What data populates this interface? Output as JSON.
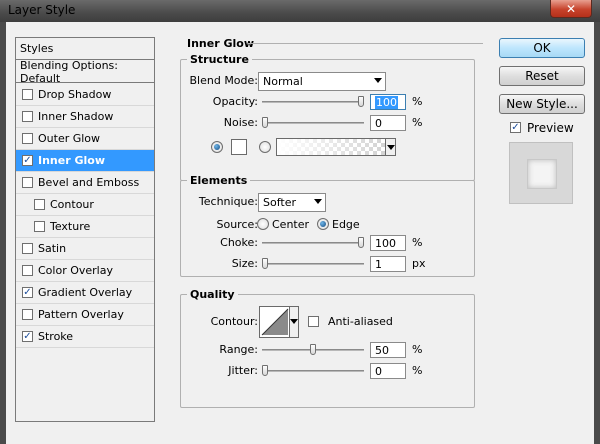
{
  "window": {
    "title": "Layer Style",
    "close_glyph": "✕"
  },
  "styles_panel": {
    "header": "Styles",
    "blending": "Blending Options: Default",
    "items": [
      {
        "label": "Drop Shadow",
        "checked": false,
        "selected": false,
        "indent": false
      },
      {
        "label": "Inner Shadow",
        "checked": false,
        "selected": false,
        "indent": false
      },
      {
        "label": "Outer Glow",
        "checked": false,
        "selected": false,
        "indent": false
      },
      {
        "label": "Inner Glow",
        "checked": true,
        "selected": true,
        "indent": false
      },
      {
        "label": "Bevel and Emboss",
        "checked": false,
        "selected": false,
        "indent": false
      },
      {
        "label": "Contour",
        "checked": false,
        "selected": false,
        "indent": true
      },
      {
        "label": "Texture",
        "checked": false,
        "selected": false,
        "indent": true
      },
      {
        "label": "Satin",
        "checked": false,
        "selected": false,
        "indent": false
      },
      {
        "label": "Color Overlay",
        "checked": false,
        "selected": false,
        "indent": false
      },
      {
        "label": "Gradient Overlay",
        "checked": true,
        "selected": false,
        "indent": false
      },
      {
        "label": "Pattern Overlay",
        "checked": false,
        "selected": false,
        "indent": false
      },
      {
        "label": "Stroke",
        "checked": true,
        "selected": false,
        "indent": false
      }
    ]
  },
  "inner_glow": {
    "title": "Inner Glow",
    "structure": {
      "title": "Structure",
      "blend_mode_label": "Blend Mode:",
      "blend_mode_value": "Normal",
      "opacity_label": "Opacity:",
      "opacity_value": "100",
      "opacity_unit": "%",
      "opacity_level": 1.0,
      "noise_label": "Noise:",
      "noise_value": "0",
      "noise_unit": "%",
      "noise_level": 0.0,
      "color_mode": "solid",
      "glow_color": "#ffffff"
    },
    "elements": {
      "title": "Elements",
      "technique_label": "Technique:",
      "technique_value": "Softer",
      "source_label": "Source:",
      "source_center": "Center",
      "source_edge": "Edge",
      "source_selected": "Edge",
      "choke_label": "Choke:",
      "choke_value": "100",
      "choke_unit": "%",
      "choke_level": 1.0,
      "size_label": "Size:",
      "size_value": "1",
      "size_unit": "px",
      "size_level": 0.0
    },
    "quality": {
      "title": "Quality",
      "contour_label": "Contour:",
      "anti_aliased_label": "Anti-aliased",
      "anti_aliased": false,
      "range_label": "Range:",
      "range_value": "50",
      "range_unit": "%",
      "range_level": 0.5,
      "jitter_label": "Jitter:",
      "jitter_value": "0",
      "jitter_unit": "%",
      "jitter_level": 0.0
    }
  },
  "buttons": {
    "ok": "OK",
    "reset": "Reset",
    "new_style": "New Style...",
    "preview_label": "Preview",
    "preview_checked": true
  },
  "colors": {
    "selection": "#3399ff",
    "dialog_bg": "#f0f0f0",
    "default_button": "#bee6fd"
  }
}
